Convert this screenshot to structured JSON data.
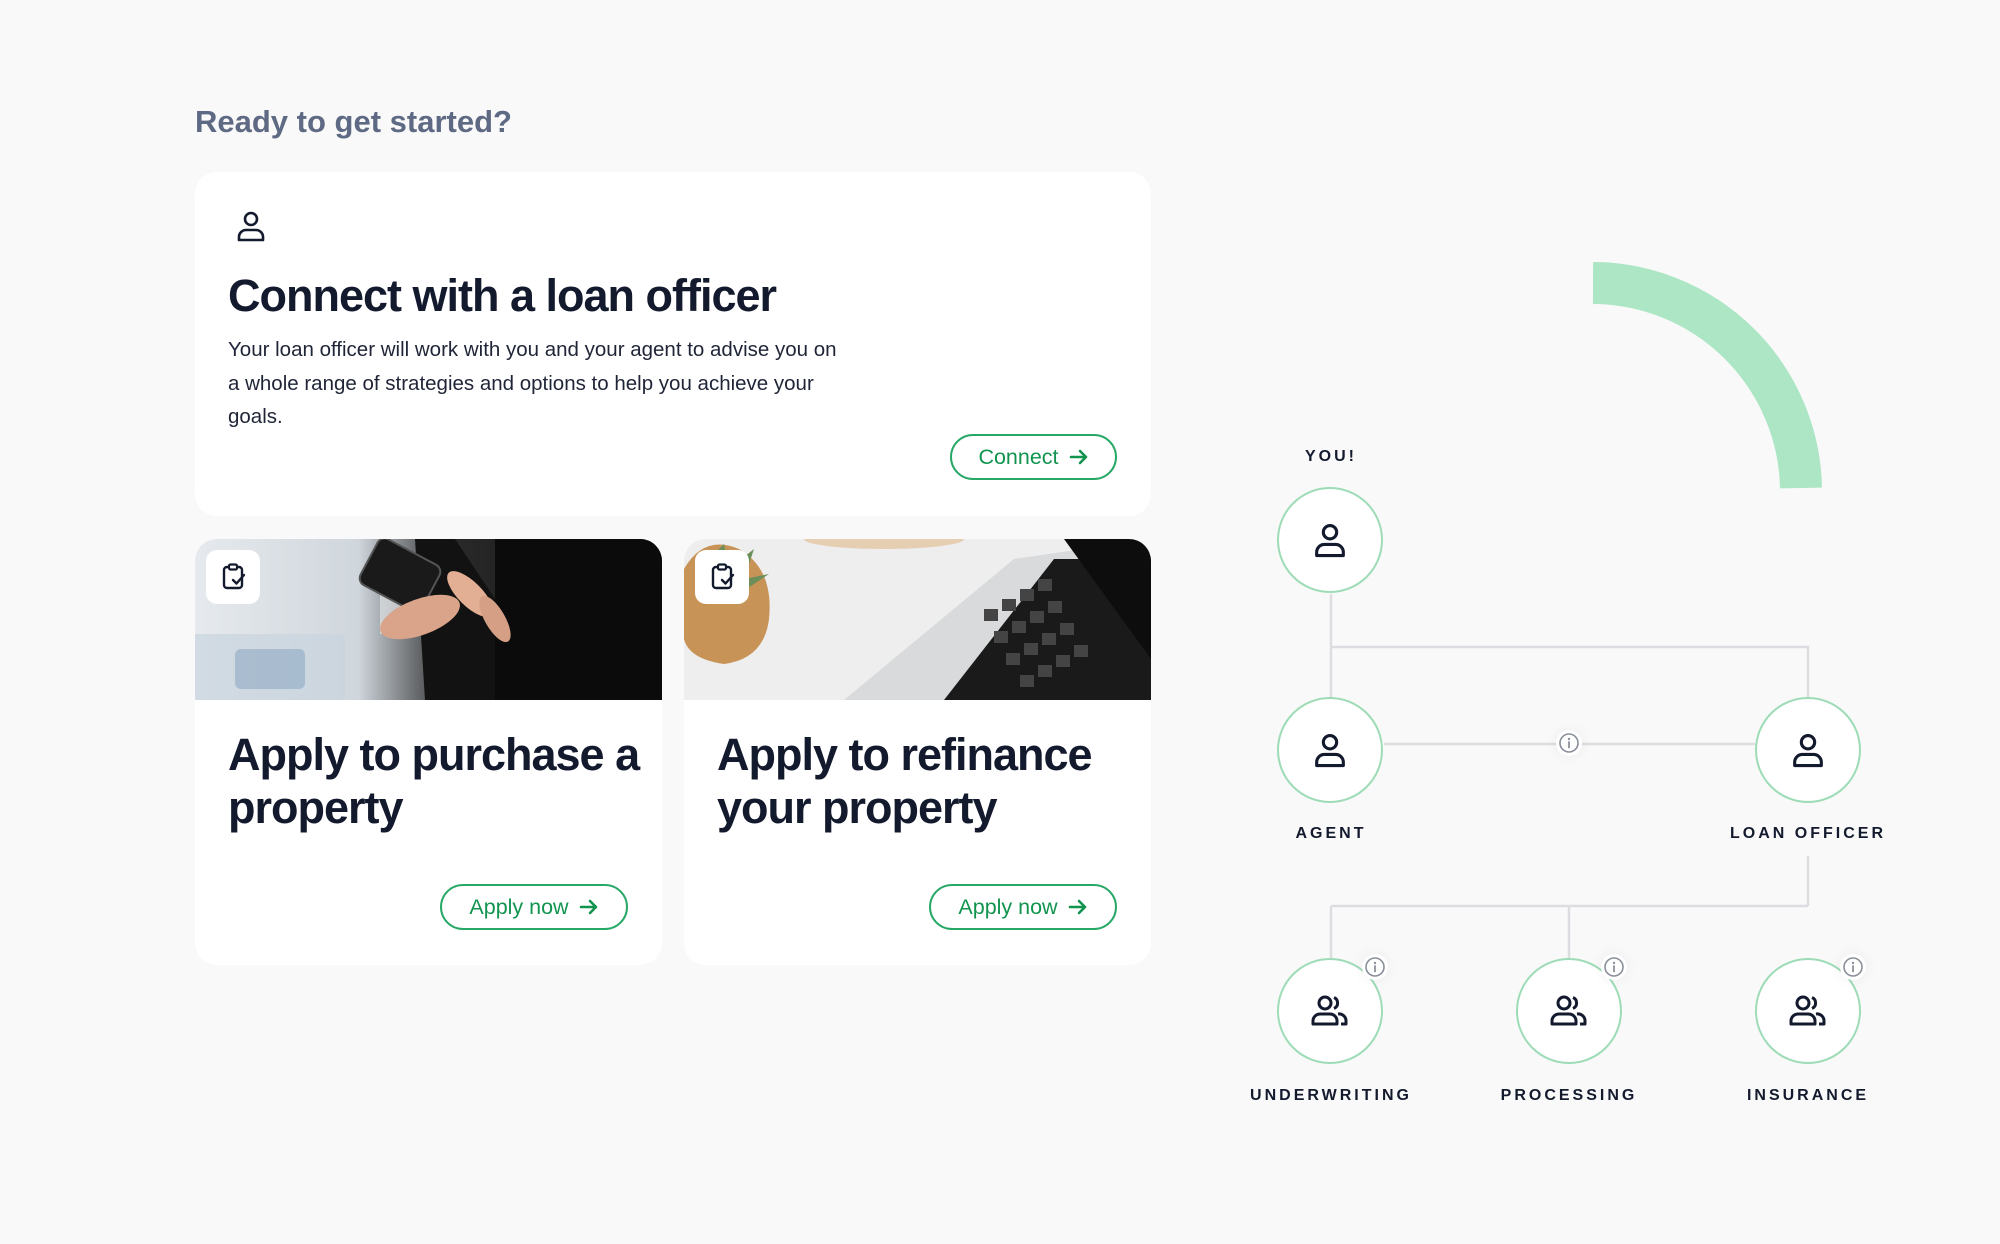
{
  "heading": "Ready to get started?",
  "connect_card": {
    "icon": "person-icon",
    "title": "Connect with a loan officer",
    "description": "Your loan officer will work with you and your agent to advise you on a whole range of strategies and options to help you achieve your goals.",
    "button_label": "Connect"
  },
  "purchase_card": {
    "icon": "clipboard-check-icon",
    "image": "hands-holding-phone-photo",
    "title": "Apply to purchase a property",
    "button_label": "Apply now"
  },
  "refinance_card": {
    "icon": "clipboard-check-icon",
    "image": "laptop-and-plant-photo",
    "title": "Apply to refinance your property",
    "button_label": "Apply now"
  },
  "org_chart": {
    "you": "YOU!",
    "agent": "AGENT",
    "loan_officer": "LOAN OFFICER",
    "underwriting": "UNDERWRITING",
    "processing": "PROCESSING",
    "insurance": "INSURANCE"
  },
  "colors": {
    "accent": "#12944f",
    "node_border": "#9ddcb6",
    "arc": "#ace6c4",
    "heading": "#5e6a84",
    "text": "#141a2e"
  }
}
